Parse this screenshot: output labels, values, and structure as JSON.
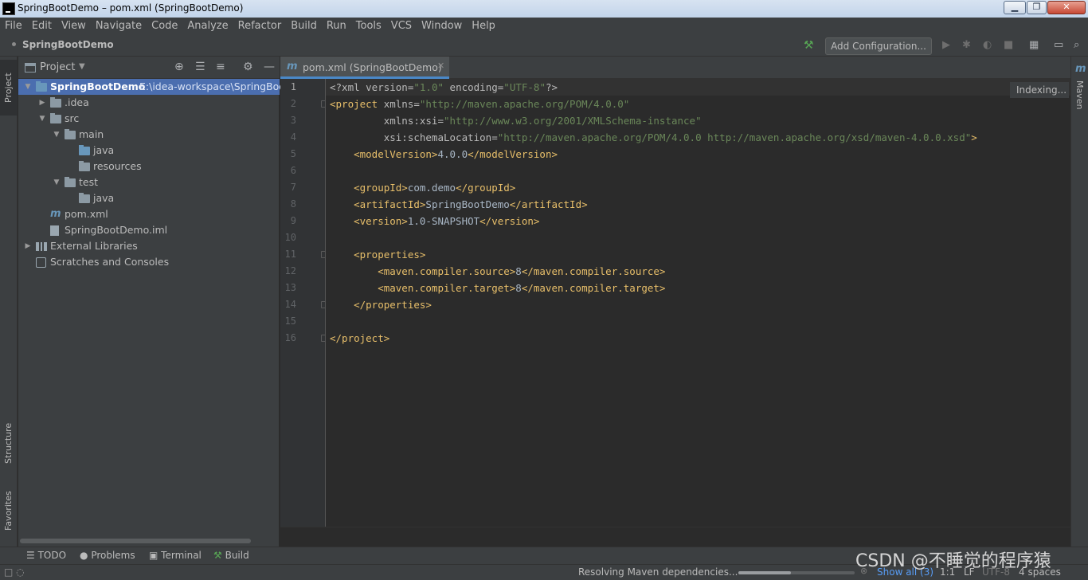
{
  "window": {
    "title": "SpringBootDemo – pom.xml (SpringBootDemo)",
    "min_label": "▁",
    "max_label": "❐",
    "close_label": "✕"
  },
  "menu": [
    "File",
    "Edit",
    "View",
    "Navigate",
    "Code",
    "Analyze",
    "Refactor",
    "Build",
    "Run",
    "Tools",
    "VCS",
    "Window",
    "Help"
  ],
  "nav": {
    "project": "SpringBootDemo",
    "add_configuration": "Add Configuration..."
  },
  "side_tabs": {
    "project": "Project",
    "structure": "Structure",
    "favorites": "Favorites",
    "maven": "Maven"
  },
  "project_panel": {
    "title": "Project",
    "tree": [
      {
        "label": "SpringBootDemo",
        "path": "E:\\idea-workspace\\SpringBoo"
      },
      {
        "label": ".idea"
      },
      {
        "label": "src"
      },
      {
        "label": "main"
      },
      {
        "label": "java"
      },
      {
        "label": "resources"
      },
      {
        "label": "test"
      },
      {
        "label": "java"
      },
      {
        "label": "pom.xml"
      },
      {
        "label": "SpringBootDemo.iml"
      },
      {
        "label": "External Libraries"
      },
      {
        "label": "Scratches and Consoles"
      }
    ]
  },
  "editor": {
    "tab": "pom.xml (SpringBootDemo)",
    "indexing": "Indexing...",
    "line_numbers": [
      "1",
      "2",
      "3",
      "4",
      "5",
      "6",
      "7",
      "8",
      "9",
      "10",
      "11",
      "12",
      "13",
      "14",
      "15",
      "16"
    ],
    "lines": [
      [
        [
          "<?xml ",
          "pi"
        ],
        [
          "version",
          "attr"
        ],
        [
          "=",
          "pi"
        ],
        [
          "\"1.0\"",
          "str"
        ],
        [
          " ",
          "pi"
        ],
        [
          "encoding",
          "attr"
        ],
        [
          "=",
          "pi"
        ],
        [
          "\"UTF-8\"",
          "str"
        ],
        [
          "?>",
          "pi"
        ]
      ],
      [
        [
          "<project ",
          "tag"
        ],
        [
          "xmlns",
          "attr"
        ],
        [
          "=",
          "attr"
        ],
        [
          "\"http://maven.apache.org/POM/4.0.0\"",
          "str"
        ]
      ],
      [
        [
          "         xmlns:xsi",
          "attr"
        ],
        [
          "=",
          "attr"
        ],
        [
          "\"http://www.w3.org/2001/XMLSchema-instance\"",
          "str"
        ]
      ],
      [
        [
          "         xsi:schemaLocation",
          "attr"
        ],
        [
          "=",
          "attr"
        ],
        [
          "\"http://maven.apache.org/POM/4.0.0 http://maven.apache.org/xsd/maven-4.0.0.xsd\"",
          "str"
        ],
        [
          ">",
          "tag"
        ]
      ],
      [
        [
          "    <modelVersion>",
          "tag"
        ],
        [
          "4.0.0",
          "txt"
        ],
        [
          "</modelVersion>",
          "tag"
        ]
      ],
      [],
      [
        [
          "    <groupId>",
          "tag"
        ],
        [
          "com.demo",
          "txt"
        ],
        [
          "</groupId>",
          "tag"
        ]
      ],
      [
        [
          "    <artifactId>",
          "tag"
        ],
        [
          "SpringBootDemo",
          "txt"
        ],
        [
          "</artifactId>",
          "tag"
        ]
      ],
      [
        [
          "    <version>",
          "tag"
        ],
        [
          "1.0-SNAPSHOT",
          "txt"
        ],
        [
          "</version>",
          "tag"
        ]
      ],
      [],
      [
        [
          "    <properties>",
          "tag"
        ]
      ],
      [
        [
          "        <maven.compiler.source>",
          "tag"
        ],
        [
          "8",
          "txt"
        ],
        [
          "</maven.compiler.source>",
          "tag"
        ]
      ],
      [
        [
          "        <maven.compiler.target>",
          "tag"
        ],
        [
          "8",
          "txt"
        ],
        [
          "</maven.compiler.target>",
          "tag"
        ]
      ],
      [
        [
          "    </properties>",
          "tag"
        ]
      ],
      [],
      [
        [
          "</project>",
          "tag"
        ]
      ]
    ]
  },
  "bottom_tabs": {
    "todo": "TODO",
    "problems": "Problems",
    "terminal": "Terminal",
    "build": "Build"
  },
  "status": {
    "task": "Resolving Maven dependencies...",
    "progress": 0.45,
    "show_all": "Show all (3)",
    "position": "1:1",
    "line_sep": "LF",
    "encoding": "UTF-8",
    "indent": "4 spaces"
  },
  "watermark": "CSDN @不睡觉的程序猿"
}
